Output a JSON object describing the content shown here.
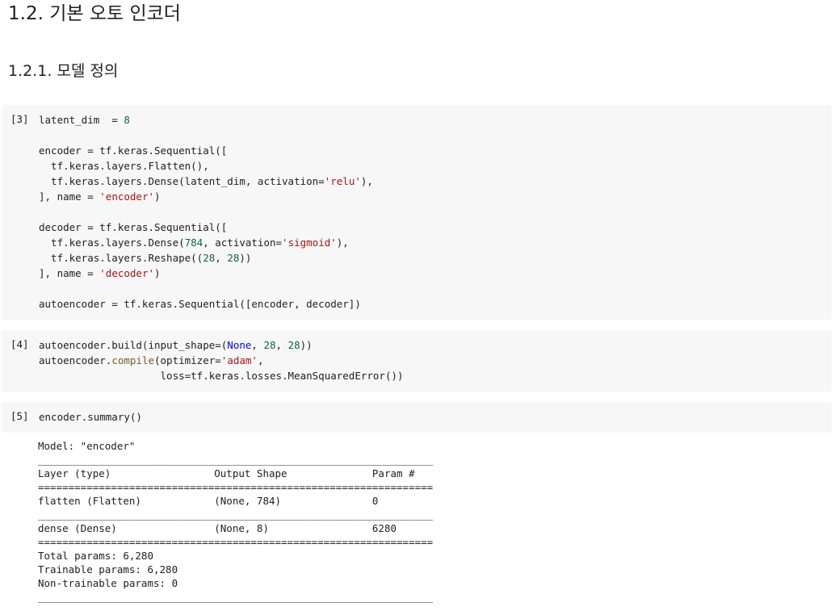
{
  "headings": {
    "section": "1.2. 기본 오토 인코더",
    "subsection": "1.2.1. 모델 정의"
  },
  "cells": [
    {
      "prompt": "[3]",
      "lines": [
        [
          {
            "t": "latent_dim  = "
          },
          {
            "t": "8",
            "c": "num"
          }
        ],
        [],
        [
          {
            "t": "encoder = tf.keras.Sequential(["
          }
        ],
        [
          {
            "t": "  tf.keras.layers.Flatten(),"
          }
        ],
        [
          {
            "t": "  tf.keras.layers.Dense(latent_dim, activation="
          },
          {
            "t": "'relu'",
            "c": "str"
          },
          {
            "t": "),"
          }
        ],
        [
          {
            "t": "], name = "
          },
          {
            "t": "'encoder'",
            "c": "str"
          },
          {
            "t": ")"
          }
        ],
        [],
        [
          {
            "t": "decoder = tf.keras.Sequential(["
          }
        ],
        [
          {
            "t": "  tf.keras.layers.Dense("
          },
          {
            "t": "784",
            "c": "num"
          },
          {
            "t": ", activation="
          },
          {
            "t": "'sigmoid'",
            "c": "str"
          },
          {
            "t": "),"
          }
        ],
        [
          {
            "t": "  tf.keras.layers.Reshape(("
          },
          {
            "t": "28",
            "c": "num"
          },
          {
            "t": ", "
          },
          {
            "t": "28",
            "c": "num"
          },
          {
            "t": "))"
          }
        ],
        [
          {
            "t": "], name = "
          },
          {
            "t": "'decoder'",
            "c": "str"
          },
          {
            "t": ")"
          }
        ],
        [],
        [
          {
            "t": "autoencoder = tf.keras.Sequential([encoder, decoder])"
          }
        ]
      ]
    },
    {
      "prompt": "[4]",
      "lines": [
        [
          {
            "t": "autoencoder.build(input_shape=("
          },
          {
            "t": "None",
            "c": "kw"
          },
          {
            "t": ", "
          },
          {
            "t": "28",
            "c": "num"
          },
          {
            "t": ", "
          },
          {
            "t": "28",
            "c": "num"
          },
          {
            "t": "))"
          }
        ],
        [
          {
            "t": "autoencoder."
          },
          {
            "t": "compile",
            "c": "fn"
          },
          {
            "t": "(optimizer="
          },
          {
            "t": "'adam'",
            "c": "str"
          },
          {
            "t": ","
          }
        ],
        [
          {
            "t": "                    loss=tf.keras.losses.MeanSquaredError())"
          }
        ]
      ]
    },
    {
      "prompt": "[5]",
      "lines": [
        [
          {
            "t": "encoder.summary()"
          }
        ]
      ]
    }
  ],
  "output": {
    "lines": [
      "Model: \"encoder\"",
      "_________________________________________________________________",
      "Layer (type)                 Output Shape              Param #   ",
      "=================================================================",
      "flatten (Flatten)            (None, 784)               0         ",
      "_________________________________________________________________",
      "dense (Dense)                (None, 8)                 6280      ",
      "=================================================================",
      "Total params: 6,280",
      "Trainable params: 6,280",
      "Non-trainable params: 0",
      "_________________________________________________________________"
    ]
  }
}
